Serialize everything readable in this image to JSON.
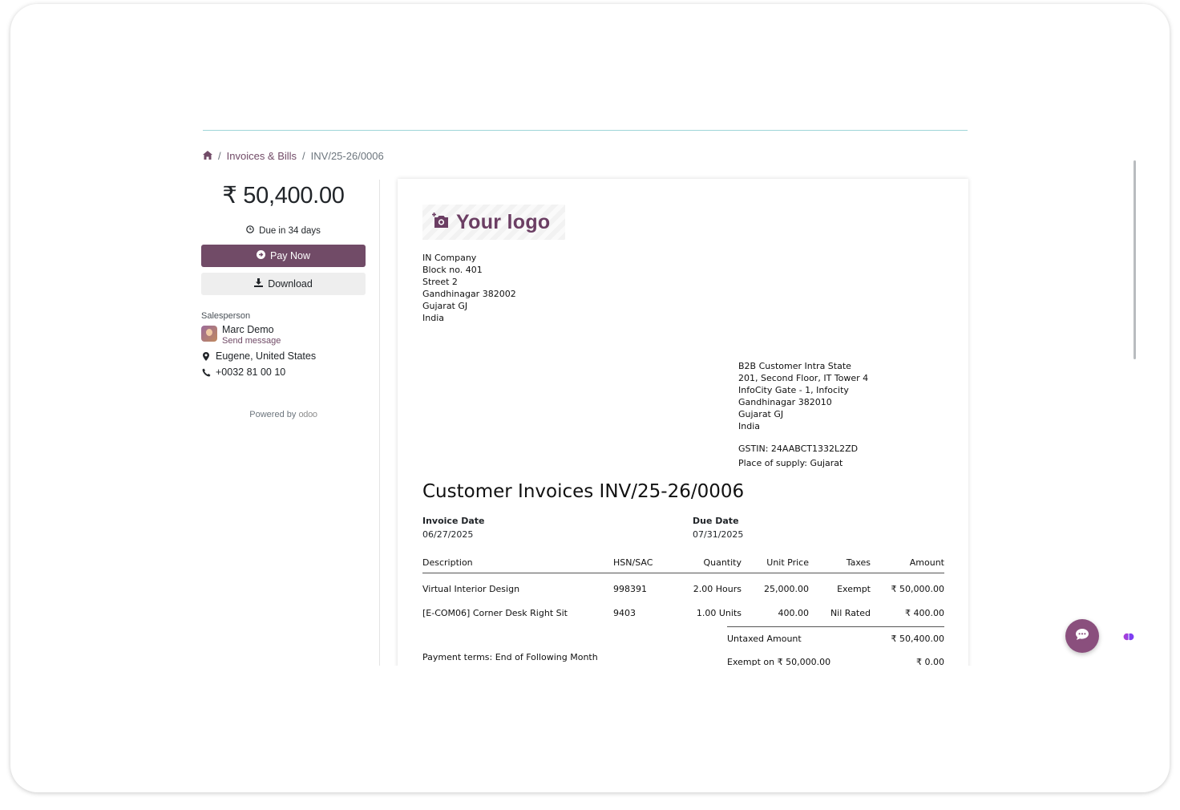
{
  "breadcrumb": {
    "home_icon": "home-icon",
    "items": [
      "Invoices & Bills",
      "INV/25-26/0006"
    ],
    "separator": "/"
  },
  "sidebar": {
    "amount": "₹ 50,400.00",
    "due_text": "Due in 34 days",
    "pay_now_label": "Pay Now",
    "download_label": "Download",
    "salesperson_label": "Salesperson",
    "salesperson_name": "Marc Demo",
    "send_message_label": "Send message",
    "location": "Eugene, United States",
    "phone": "+0032 81 00 10",
    "powered_by": "Powered by",
    "powered_brand": "odoo"
  },
  "document": {
    "logo_text": "Your logo",
    "company_address": [
      "IN Company",
      "Block no. 401",
      "Street 2",
      "Gandhinagar 382002",
      "Gujarat GJ",
      "India"
    ],
    "customer_address": [
      "B2B Customer Intra State",
      "201, Second Floor, IT Tower 4",
      "InfoCity Gate - 1, Infocity",
      "Gandhinagar 382010",
      "Gujarat GJ",
      "India"
    ],
    "gstin": "GSTIN: 24AABCT1332L2ZD",
    "place_of_supply": "Place of supply: Gujarat",
    "title": "Customer Invoices INV/25-26/0006",
    "invoice_date_label": "Invoice Date",
    "invoice_date": "06/27/2025",
    "due_date_label": "Due Date",
    "due_date": "07/31/2025",
    "columns": [
      "Description",
      "HSN/SAC",
      "Quantity",
      "Unit Price",
      "Taxes",
      "Amount"
    ],
    "lines": [
      {
        "description": "Virtual Interior Design",
        "hsn": "998391",
        "quantity": "2.00 Hours",
        "unit_price": "25,000.00",
        "taxes": "Exempt",
        "amount": "₹ 50,000.00"
      },
      {
        "description": "[E-COM06] Corner Desk Right Sit",
        "hsn": "9403",
        "quantity": "1.00 Units",
        "unit_price": "400.00",
        "taxes": "Nil Rated",
        "amount": "₹ 400.00"
      }
    ],
    "untaxed_label": "Untaxed Amount",
    "untaxed_value": "₹ 50,400.00",
    "exempt_label": "Exempt on ₹ 50,000.00",
    "exempt_value": "₹ 0.00",
    "payment_terms": "Payment terms: End of Following Month"
  },
  "colors": {
    "primary": "#714b67",
    "accent_rule": "#9fd5d8"
  },
  "icons": {
    "chat": "chat-bubble-icon",
    "assistant": "brain-icon"
  }
}
